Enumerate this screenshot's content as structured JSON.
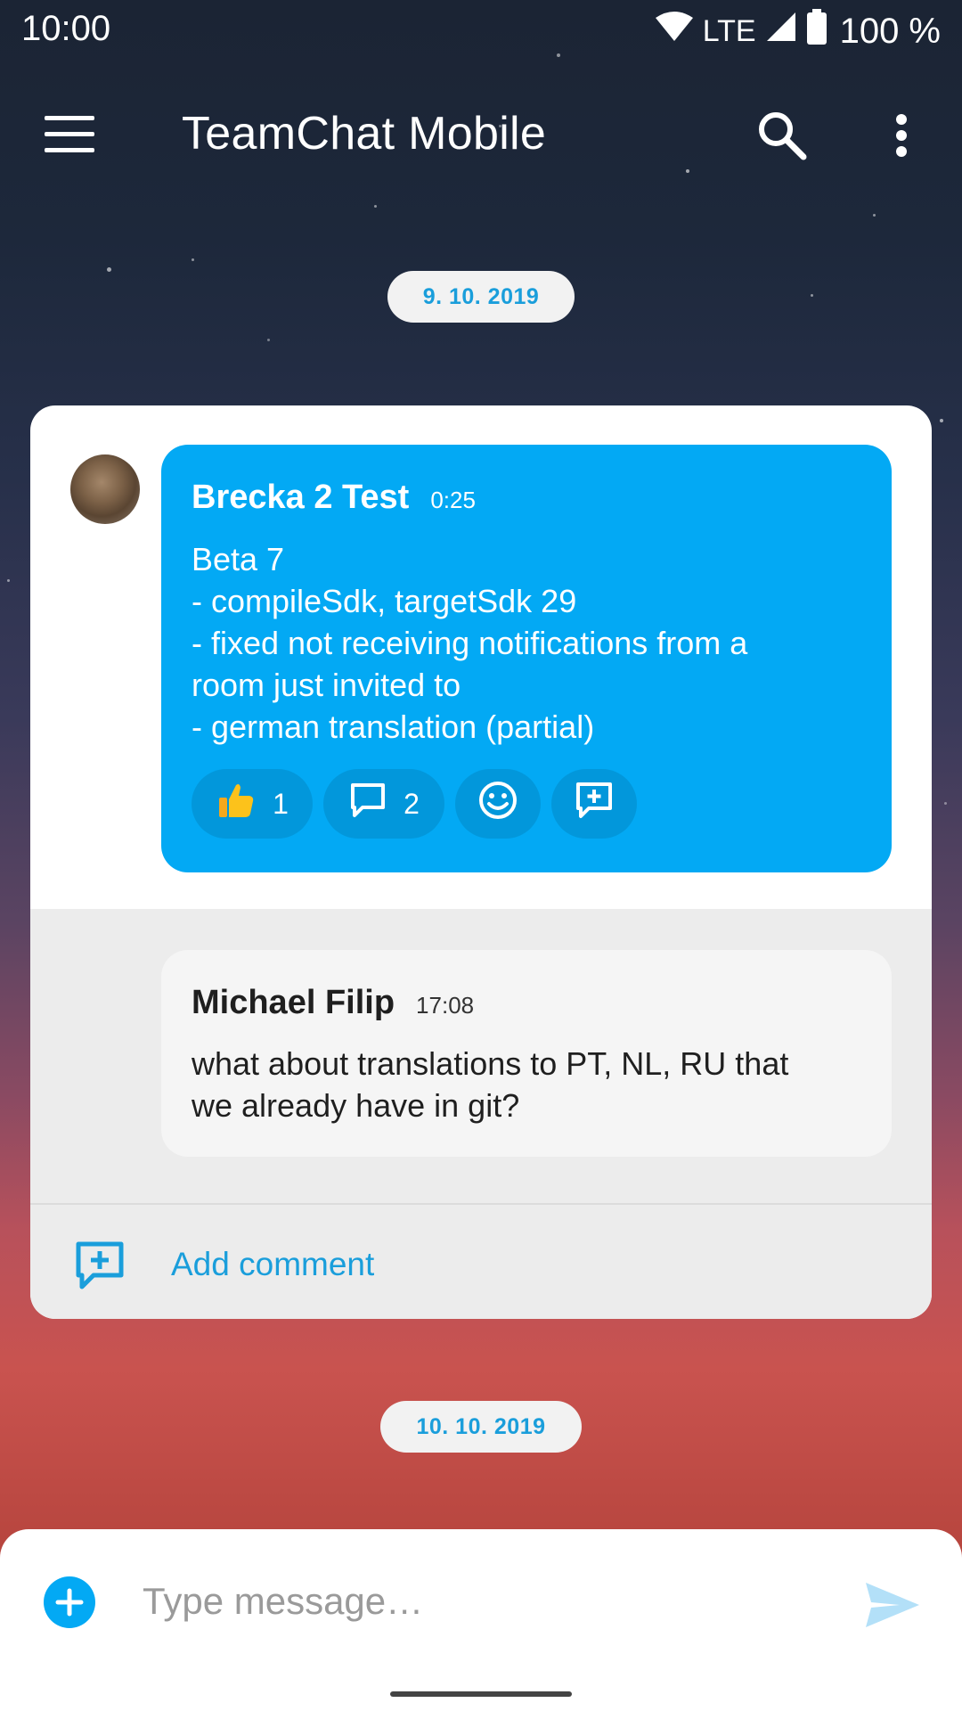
{
  "status_bar": {
    "time": "10:00",
    "network": "LTE",
    "battery": "100 %",
    "icons": [
      "wifi-icon",
      "signal-icon",
      "battery-icon"
    ]
  },
  "app_bar": {
    "title": "TeamChat Mobile",
    "icons": [
      "menu-icon",
      "search-icon",
      "more-vert-icon"
    ]
  },
  "timeline": {
    "date_1": "9. 10. 2019",
    "date_2": "10. 10. 2019"
  },
  "thread": {
    "message": {
      "author": "Brecka 2 Test",
      "time": "0:25",
      "lines": [
        "Beta 7",
        "- compileSdk, targetSdk 29",
        "- fixed not receiving notifications from a",
        "room just invited to",
        "- german translation (partial)"
      ],
      "reactions": {
        "likes": "1",
        "comments": "2"
      }
    },
    "comment": {
      "author": "Michael Filip",
      "time": "17:08",
      "lines": [
        "what about translations to PT, NL, RU that",
        "we already have in git?"
      ]
    },
    "add_comment_label": "Add comment"
  },
  "composer": {
    "placeholder": "Type message…"
  },
  "colors": {
    "accent": "#03a9f4",
    "link": "#1a9edb",
    "chip_bg": "#f2f2f2",
    "comment_bg": "#ececec"
  }
}
